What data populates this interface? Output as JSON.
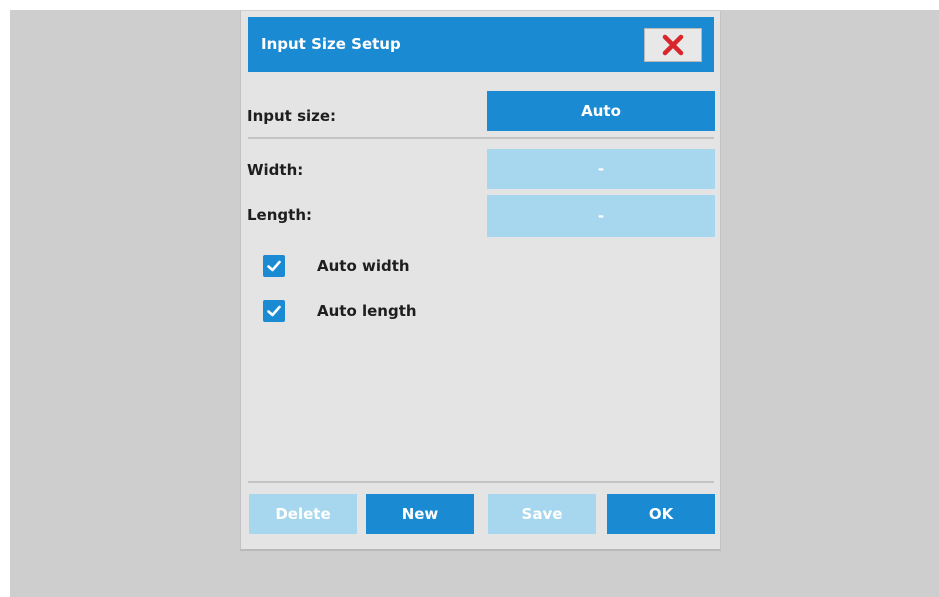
{
  "dialog": {
    "title": "Input Size Setup",
    "close_icon": "close-x-icon"
  },
  "input_size": {
    "label": "Input size:",
    "value": "Auto"
  },
  "width": {
    "label": "Width:",
    "value": "-"
  },
  "length": {
    "label": "Length:",
    "value": "-"
  },
  "checkboxes": [
    {
      "label": "Auto width",
      "checked": true
    },
    {
      "label": "Auto length",
      "checked": true
    }
  ],
  "buttons": {
    "delete": "Delete",
    "new": "New",
    "save": "Save",
    "ok": "OK"
  },
  "colors": {
    "accent": "#1a8ad2",
    "disabled": "#a6d7ee",
    "close_x": "#d8272c",
    "dialog_bg": "#e4e4e4",
    "backdrop": "#cecece"
  }
}
